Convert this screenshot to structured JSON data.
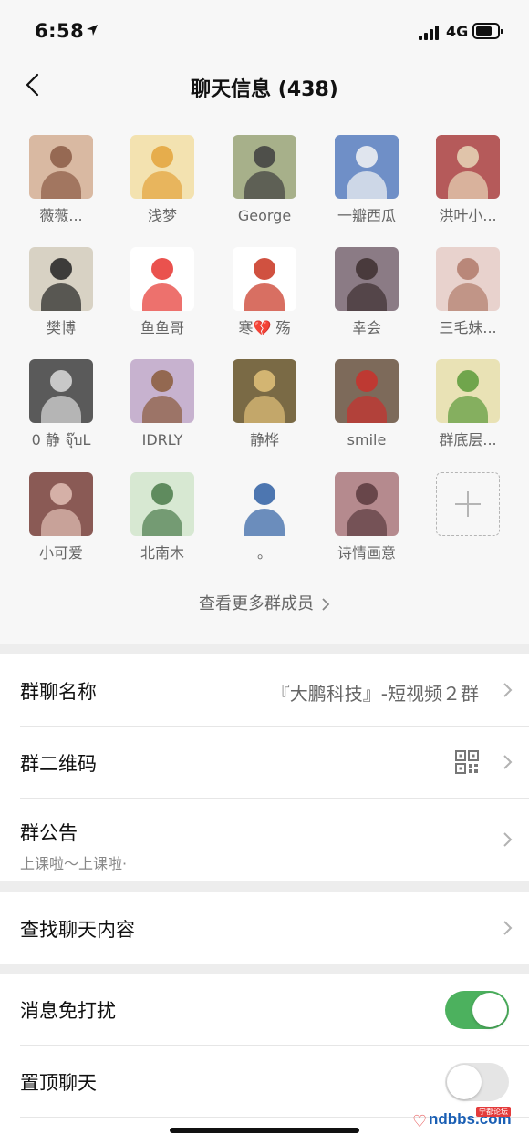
{
  "status": {
    "time": "6:58",
    "network": "4G",
    "battery_level": 0.75
  },
  "header": {
    "title": "聊天信息 (438)"
  },
  "members": [
    {
      "name": "薇薇...",
      "bg": "#d9b9a2",
      "fg": "#8a5a45"
    },
    {
      "name": "浅梦",
      "bg": "#f3e2b0",
      "fg": "#e3a33b"
    },
    {
      "name": "George",
      "bg": "#a7b08a",
      "fg": "#3e3e3e"
    },
    {
      "name": "一瓣西瓜",
      "bg": "#6f8fc7",
      "fg": "#f5f5f5"
    },
    {
      "name": "洪叶小...",
      "bg": "#b55a5a",
      "fg": "#e8d7b8"
    },
    {
      "name": "樊博",
      "bg": "#d8d2c4",
      "fg": "#222222"
    },
    {
      "name": "鱼鱼哥",
      "bg": "#ffffff",
      "fg": "#e6342f"
    },
    {
      "name": "寒💔 殇",
      "bg": "#ffffff",
      "fg": "#c8321f"
    },
    {
      "name": "幸会",
      "bg": "#8b7b85",
      "fg": "#3d2f2f"
    },
    {
      "name": "三毛妹...",
      "bg": "#e8d2cd",
      "fg": "#b07a6a"
    },
    {
      "name": "0 静 จุ๊บL",
      "bg": "#5a5a5a",
      "fg": "#dcdcdc"
    },
    {
      "name": "IDRLY",
      "bg": "#c7b2cf",
      "fg": "#8a5a3a"
    },
    {
      "name": "静桦",
      "bg": "#7a6a45",
      "fg": "#e3c27a"
    },
    {
      "name": "smile",
      "bg": "#7d6a5a",
      "fg": "#c9302c"
    },
    {
      "name": "群底层...",
      "bg": "#e9e2b5",
      "fg": "#5a9a3a"
    },
    {
      "name": "小可爱",
      "bg": "#8a5a55",
      "fg": "#e2c0b6"
    },
    {
      "name": "北南木",
      "bg": "#d7e8d2",
      "fg": "#4a7a4a"
    },
    {
      "name": "。",
      "bg": "#f7f7f7",
      "fg": "#2f5fa3"
    },
    {
      "name": "诗情画意",
      "bg": "#b58a8e",
      "fg": "#5a3a3e"
    }
  ],
  "more_members_label": "查看更多群成员",
  "settings": {
    "group_name": {
      "label": "群聊名称",
      "value": "『大鹏科技』-短视频２群"
    },
    "qr_code": {
      "label": "群二维码"
    },
    "notice": {
      "label": "群公告",
      "text": "上课啦～上课啦·"
    },
    "search": {
      "label": "查找聊天内容"
    },
    "mute": {
      "label": "消息免打扰",
      "on": true
    },
    "pin": {
      "label": "置顶聊天",
      "on": false
    }
  },
  "watermark": {
    "text": "ndbbs.com",
    "badge": "宁都论坛"
  },
  "colors": {
    "accent_green": "#4cb15e",
    "background": "#ededed"
  }
}
